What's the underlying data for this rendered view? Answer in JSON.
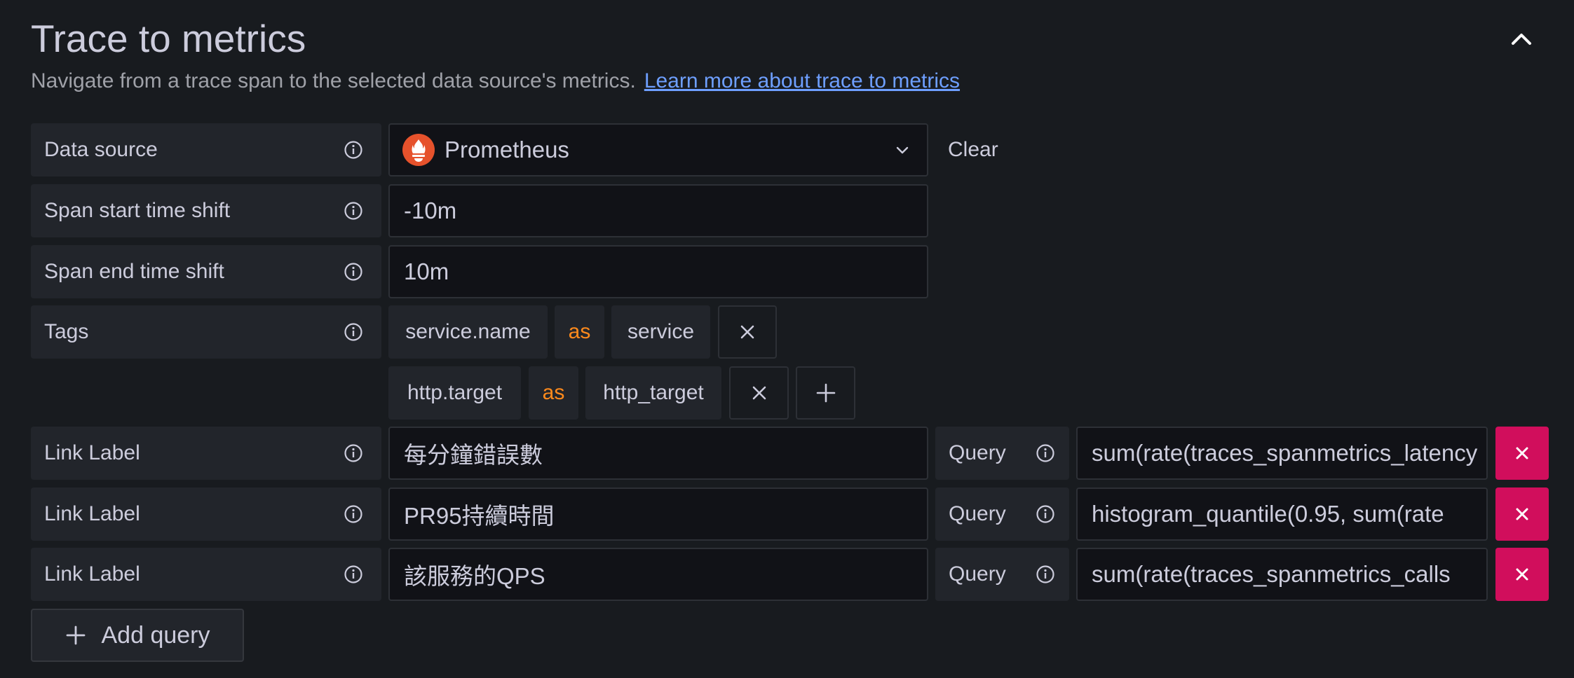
{
  "header": {
    "title": "Trace to metrics",
    "description": "Navigate from a trace span to the selected data source's metrics.",
    "learn_more": "Learn more about trace to metrics"
  },
  "datasource": {
    "label": "Data source",
    "value": "Prometheus",
    "clear": "Clear",
    "icon": "prometheus-logo-icon"
  },
  "span_start": {
    "label": "Span start time shift",
    "value": "-10m"
  },
  "span_end": {
    "label": "Span end time shift",
    "value": "10m"
  },
  "tags": {
    "label": "Tags",
    "items": [
      {
        "key": "service.name",
        "as": "as",
        "value": "service"
      },
      {
        "key": "http.target",
        "as": "as",
        "value": "http_target"
      }
    ]
  },
  "queries": [
    {
      "label": "Link Label",
      "value": "每分鐘錯誤數",
      "query_label": "Query",
      "query": "sum(rate(traces_spanmetrics_latency"
    },
    {
      "label": "Link Label",
      "value": "PR95持續時間",
      "query_label": "Query",
      "query": "histogram_quantile(0.95, sum(rate"
    },
    {
      "label": "Link Label",
      "value": "該服務的QPS",
      "query_label": "Query",
      "query": "sum(rate(traces_spanmetrics_calls"
    }
  ],
  "add_query": "Add query",
  "colors": {
    "background": "#181b1f",
    "accent_link": "#6e9fff",
    "as_text": "#ff8a1c",
    "delete_button": "#d10e5c",
    "prometheus": "#e6522c"
  }
}
